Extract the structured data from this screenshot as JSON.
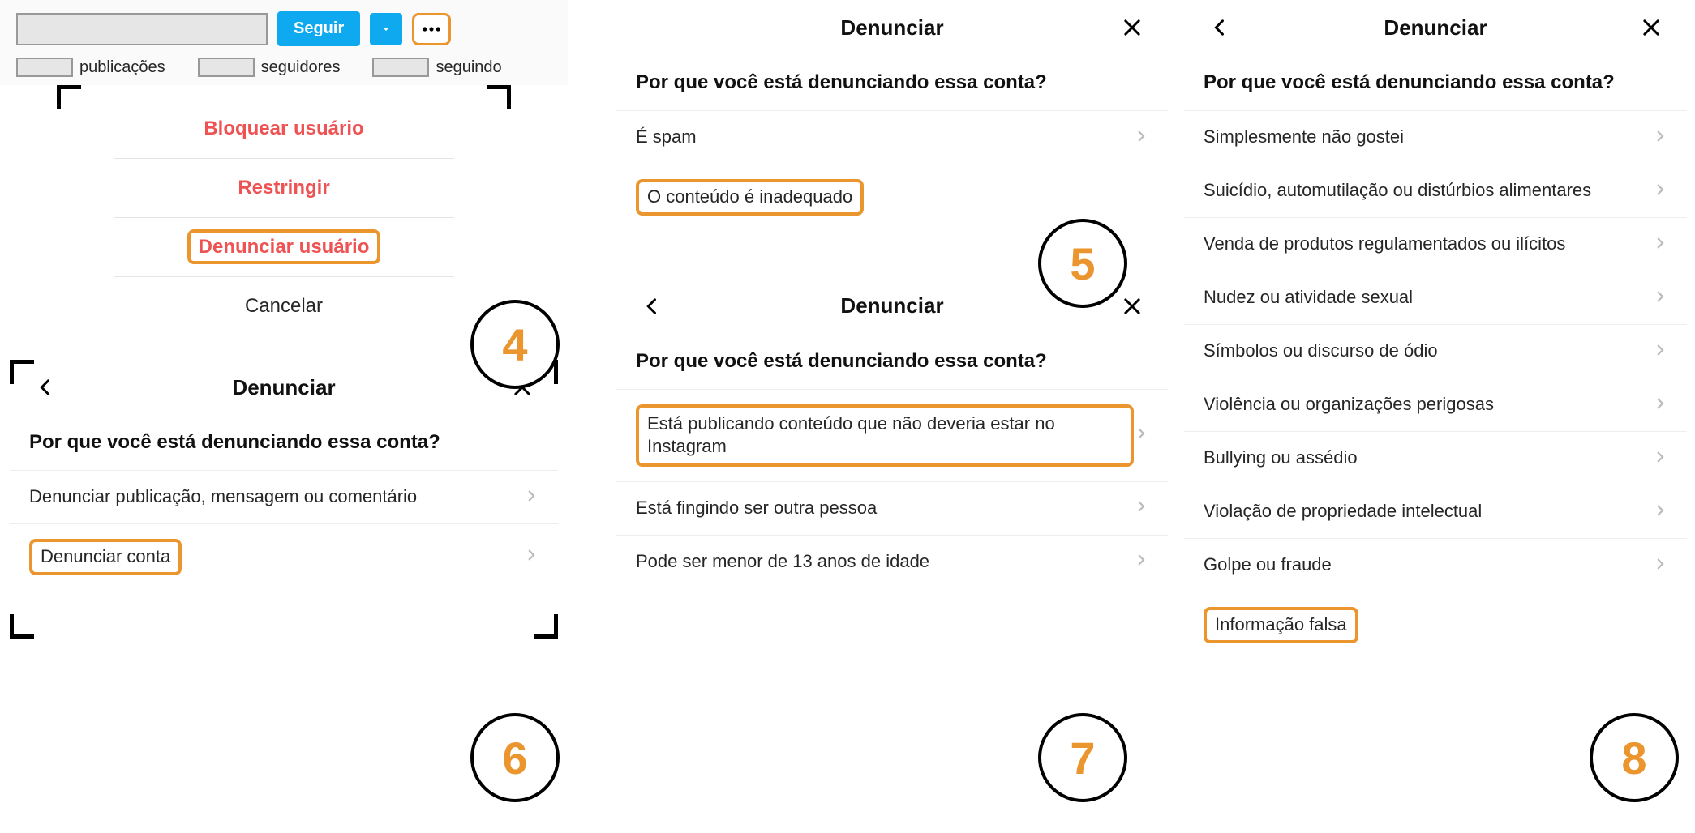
{
  "profile": {
    "follow_label": "Seguir",
    "stats": {
      "posts_label": "publicações",
      "followers_label": "seguidores",
      "following_label": "seguindo"
    }
  },
  "action_sheet": {
    "block": "Bloquear usuário",
    "restrict": "Restringir",
    "report": "Denunciar usuário",
    "cancel": "Cancelar"
  },
  "report": {
    "title": "Denunciar",
    "question": "Por que você está denunciando essa conta?"
  },
  "panel5": {
    "opt1": "É spam",
    "opt2": "O conteúdo é inadequado"
  },
  "panel6": {
    "opt1": "Denunciar publicação, mensagem ou comentário",
    "opt2": "Denunciar conta"
  },
  "panel7": {
    "opt1": "Está publicando conteúdo que não deveria estar no Instagram",
    "opt2": "Está fingindo ser outra pessoa",
    "opt3": "Pode ser menor de 13 anos de idade"
  },
  "panel8": {
    "opt1": "Simplesmente não gostei",
    "opt2": "Suicídio, automutilação ou distúrbios alimentares",
    "opt3": "Venda de produtos regulamentados ou ilícitos",
    "opt4": "Nudez ou atividade sexual",
    "opt5": "Símbolos ou discurso de ódio",
    "opt6": "Violência ou organizações perigosas",
    "opt7": "Bullying ou assédio",
    "opt8": "Violação de propriedade intelectual",
    "opt9": "Golpe ou fraude",
    "opt10": "Informação falsa"
  },
  "steps": {
    "s4": "4",
    "s5": "5",
    "s6": "6",
    "s7": "7",
    "s8": "8"
  }
}
